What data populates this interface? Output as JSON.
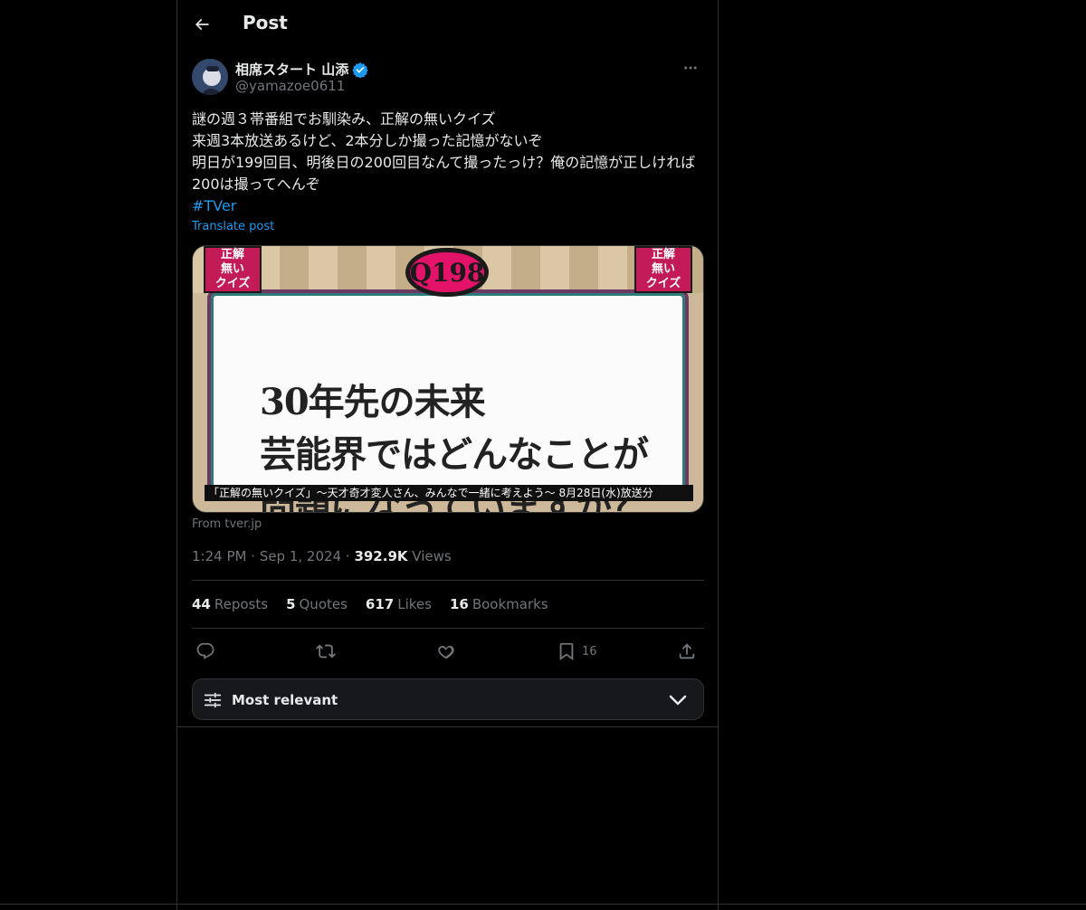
{
  "header": {
    "title": "Post"
  },
  "author": {
    "display_name": "相席スタート 山添",
    "handle": "@yamazoe0611",
    "verified": true
  },
  "post": {
    "lines": [
      "謎の週３帯番組でお馴染み、正解の無いクイズ",
      "来週3本放送あるけど、2本分しか撮った記憶がないぞ",
      "明日が199回目、明後日の200回目なんて撮ったっけ？俺の記憶が正しければ200は撮ってへんぞ"
    ],
    "hashtag": "#TVer",
    "translate_label": "Translate post"
  },
  "media": {
    "logo_text_left": [
      "正解",
      "無い",
      "クイズ"
    ],
    "logo_text_right": [
      "正解",
      "無い",
      "クイズ"
    ],
    "badge": "Q198",
    "question_lines": [
      "30年先の未来",
      "芸能界ではどんなことが",
      "問題になっていますか？"
    ],
    "caption": "「正解の無いクイズ」〜天才奇才変人さん、みんなで一緒に考えよう〜 8月28日(水)放送分"
  },
  "source": "From tver.jp",
  "meta": {
    "time": "1:24 PM",
    "date": "Sep 1, 2024",
    "views_count": "392.9K",
    "views_label": "Views",
    "separator": "·"
  },
  "stats": [
    {
      "count": "44",
      "label": "Reposts"
    },
    {
      "count": "5",
      "label": "Quotes"
    },
    {
      "count": "617",
      "label": "Likes"
    },
    {
      "count": "16",
      "label": "Bookmarks"
    }
  ],
  "actions": {
    "reply_icon": "reply-icon",
    "repost_icon": "repost-icon",
    "like_icon": "heart-icon",
    "bookmark_icon": "bookmark-icon",
    "bookmark_count": "16",
    "share_icon": "share-icon"
  },
  "sort": {
    "label": "Most relevant"
  },
  "colors": {
    "background": "#000000",
    "text": "#e7e9ea",
    "secondary": "#71767b",
    "accent": "#1d9bf0",
    "border": "#2f3336",
    "verified": "#1d9bf0"
  }
}
